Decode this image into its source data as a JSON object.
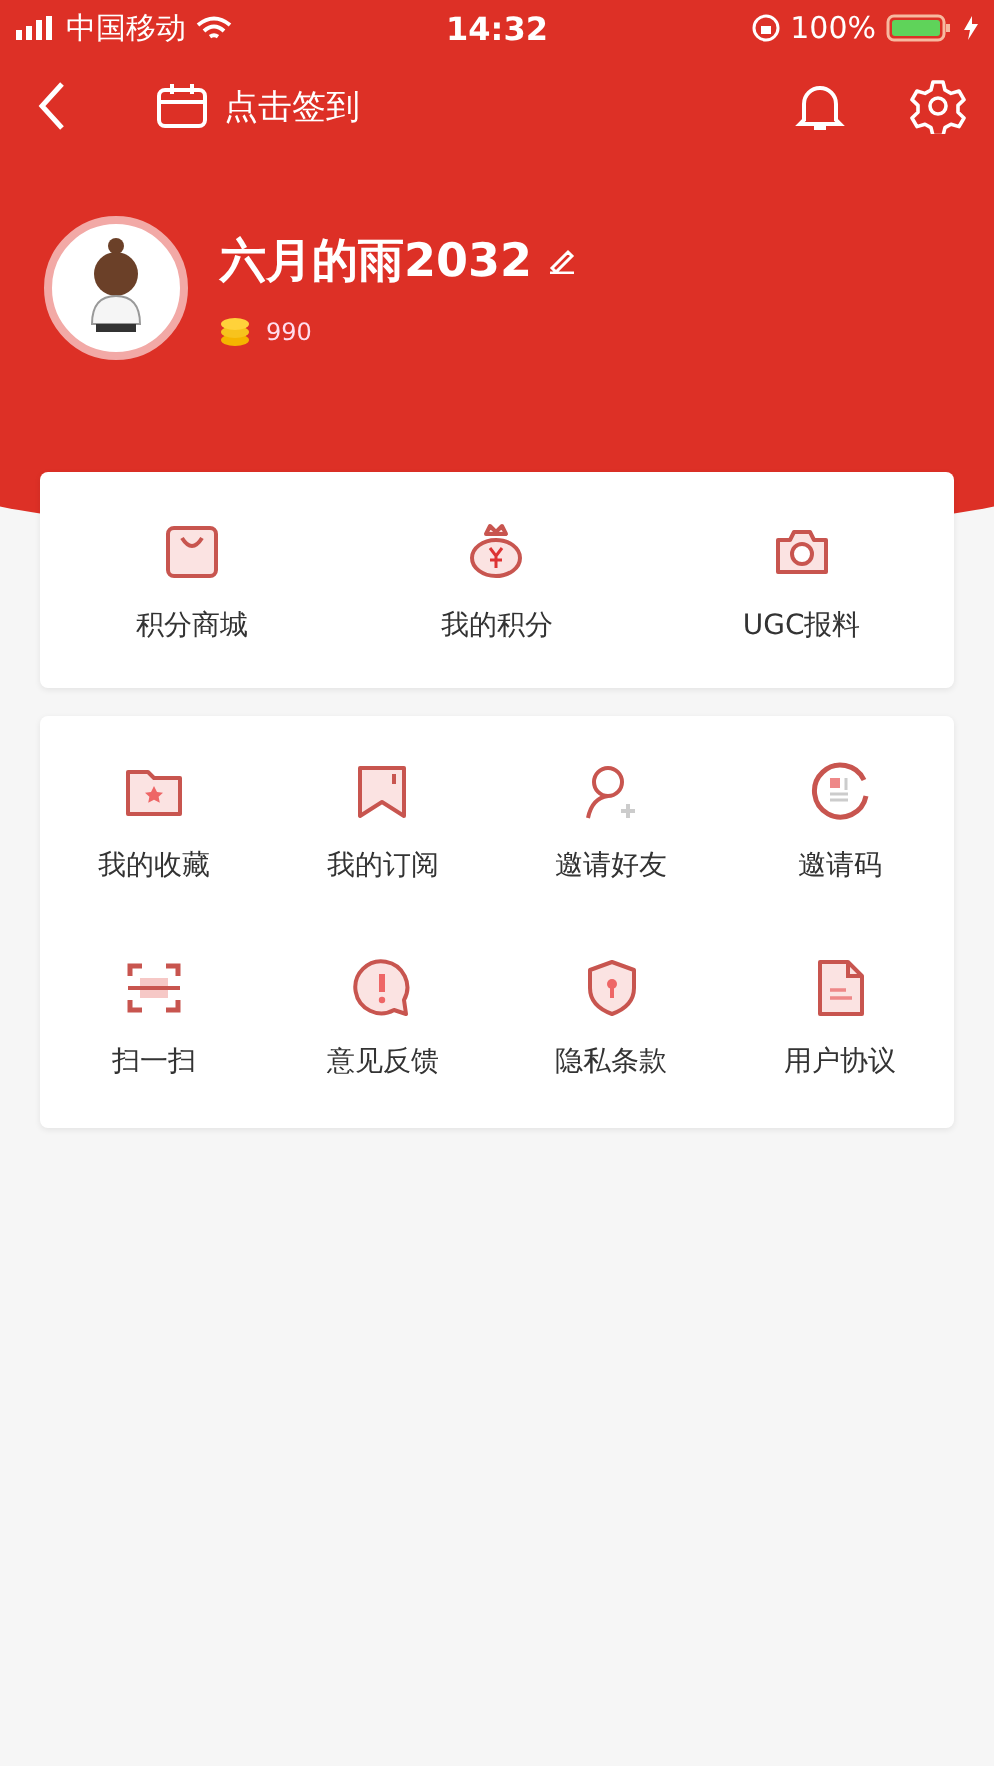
{
  "status_bar": {
    "carrier": "中国移动",
    "time": "14:32",
    "battery": "100%"
  },
  "nav": {
    "checkin": "点击签到"
  },
  "profile": {
    "name": "六月的雨2032",
    "points": "990"
  },
  "shortcuts": [
    {
      "label": "积分商城"
    },
    {
      "label": "我的积分"
    },
    {
      "label": "UGC报料"
    }
  ],
  "menu": [
    {
      "label": "我的收藏"
    },
    {
      "label": "我的订阅"
    },
    {
      "label": "邀请好友"
    },
    {
      "label": "邀请码"
    },
    {
      "label": "扫一扫"
    },
    {
      "label": "意见反馈"
    },
    {
      "label": "隐私条款"
    },
    {
      "label": "用户协议"
    }
  ]
}
